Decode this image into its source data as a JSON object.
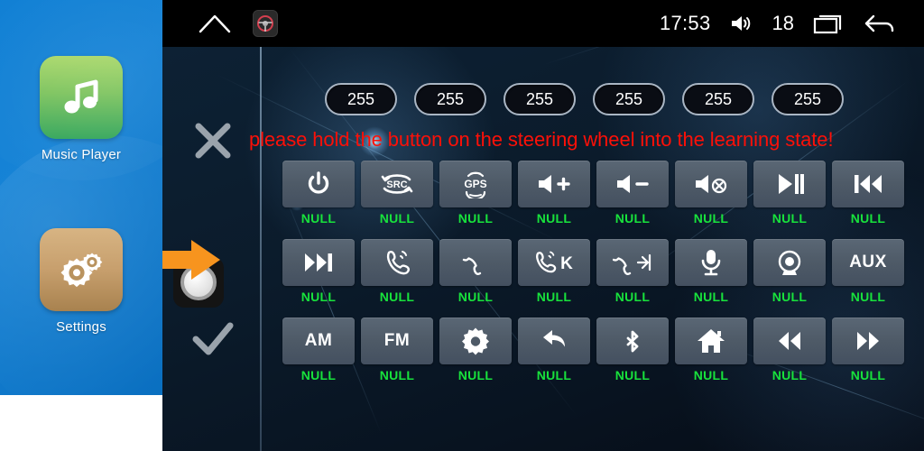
{
  "sidebar": {
    "apps": [
      {
        "label": "Music Player",
        "icon": "music-note-icon",
        "icon_style": "icon-music"
      },
      {
        "label": "Settings",
        "icon": "gears-icon",
        "icon_style": "icon-settings"
      }
    ]
  },
  "statusbar": {
    "home_icon": "home-outline-icon",
    "steering_icon": "steering-wheel-icon",
    "time": "17:53",
    "volume_icon": "speaker-icon",
    "volume_level": "18",
    "recents_icon": "recents-icon",
    "back_icon": "back-arrow-icon"
  },
  "rail": {
    "close_icon": "close-x-icon",
    "confirm_icon": "checkmark-icon",
    "knob_icon": "rotary-knob-icon",
    "pointer_icon": "orange-arrow-icon"
  },
  "pills": {
    "values": [
      "255",
      "255",
      "255",
      "255",
      "255",
      "255"
    ]
  },
  "warning": {
    "text": "please hold the button on the steering wheel into the learning state!",
    "color": "#fd1008"
  },
  "grid": {
    "label_color": "#18e23c",
    "rows": [
      [
        {
          "icon": "power-icon",
          "glyph": "",
          "label": "NULL"
        },
        {
          "icon": "src-source-icon",
          "glyph": "",
          "label": "NULL"
        },
        {
          "icon": "gps-icon",
          "glyph": "",
          "label": "NULL"
        },
        {
          "icon": "volume-up-icon",
          "glyph": "",
          "label": "NULL"
        },
        {
          "icon": "volume-down-icon",
          "glyph": "",
          "label": "NULL"
        },
        {
          "icon": "mute-icon",
          "glyph": "",
          "label": "NULL"
        },
        {
          "icon": "play-pause-icon",
          "glyph": "",
          "label": "NULL"
        },
        {
          "icon": "previous-track-icon",
          "glyph": "",
          "label": "NULL"
        }
      ],
      [
        {
          "icon": "next-track-icon",
          "glyph": "",
          "label": "NULL"
        },
        {
          "icon": "phone-answer-icon",
          "glyph": "",
          "label": "NULL"
        },
        {
          "icon": "phone-hangup-icon",
          "glyph": "",
          "label": "NULL"
        },
        {
          "icon": "phone-answer-k-icon",
          "glyph": "",
          "label": "NULL"
        },
        {
          "icon": "phone-hangup-arrow-icon",
          "glyph": "",
          "label": "NULL"
        },
        {
          "icon": "microphone-icon",
          "glyph": "",
          "label": "NULL"
        },
        {
          "icon": "camera-icon",
          "glyph": "",
          "label": "NULL"
        },
        {
          "icon": "aux-text-icon",
          "glyph": "AUX",
          "label": "NULL"
        }
      ],
      [
        {
          "icon": "am-text-icon",
          "glyph": "AM",
          "label": "NULL"
        },
        {
          "icon": "fm-text-icon",
          "glyph": "FM",
          "label": "NULL"
        },
        {
          "icon": "settings-gear-icon",
          "glyph": "",
          "label": "NULL"
        },
        {
          "icon": "back-curve-icon",
          "glyph": "",
          "label": "NULL"
        },
        {
          "icon": "bluetooth-icon",
          "glyph": "",
          "label": "NULL"
        },
        {
          "icon": "home-icon",
          "glyph": "",
          "label": "NULL"
        },
        {
          "icon": "rewind-icon",
          "glyph": "",
          "label": "NULL"
        },
        {
          "icon": "fast-forward-icon",
          "glyph": "",
          "label": "NULL"
        }
      ]
    ]
  }
}
